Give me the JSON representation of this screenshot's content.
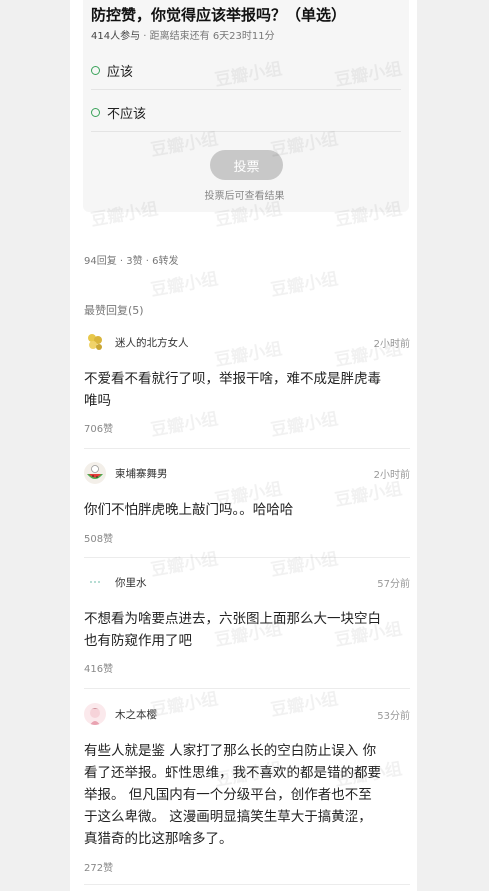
{
  "poll": {
    "title": "防控赞，你觉得应该举报吗？（单选）",
    "participants": "414人参与",
    "deadline": "· 距离结束还有 6天23时11分",
    "options": [
      "应该",
      "不应该"
    ],
    "vote_button": "投票",
    "vote_hint": "投票后可查看结果"
  },
  "stats": "94回复 · 3赞 · 6转发",
  "comments_section_title": "最赞回复(5)",
  "comments": [
    {
      "name": "迷人的北方女人",
      "time": "2小时前",
      "text": "不爱看不看就行了呗，举报干啥，难不成是胖虎毒\n唯吗",
      "likes": "706赞"
    },
    {
      "name": "柬埔寨舞男",
      "time": "2小时前",
      "text": "你们不怕胖虎晚上敲门吗。。哈哈哈",
      "likes": "508赞"
    },
    {
      "name": "你里水",
      "time": "57分前",
      "text": "不想看为啥要点进去，六张图上面那么大一块空白\n也有防窥作用了吧",
      "likes": "416赞"
    },
    {
      "name": "木之本樱",
      "time": "53分前",
      "text": "有些人就是鉴 人家打了那么长的空白防止误入 你\n看了还举报。虾性思维，我不喜欢的都是错的都要\n举报。 但凡国内有一个分级平台，创作者也不至\n于这么卑微。 这漫画明显搞笑生草大于搞黄涩，\n真猎奇的比这那啥多了。",
      "likes": "272赞"
    }
  ],
  "watermark": "豆瓣小组",
  "colors": {
    "accent": "#3aa35a",
    "button": "#c8c8c8"
  }
}
